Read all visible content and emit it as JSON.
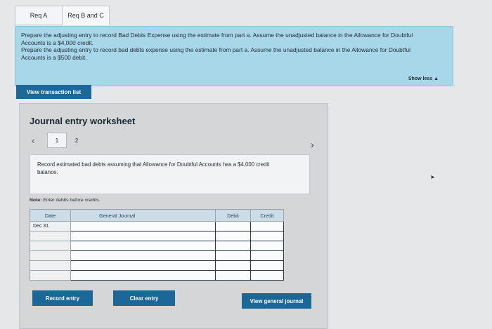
{
  "tabs": [
    {
      "label": "Req A"
    },
    {
      "label": "Req B and C"
    }
  ],
  "instructions": {
    "line1": "Prepare the adjusting entry to record Bad Debts Expense using the estimate from part a. Assume the unadjusted balance in the Allowance for Doubtful Accounts is a $4,000 credit.",
    "line2": "Prepare the adjusting entry to record bad debts expense using the estimate from part a. Assume the unadjusted balance in the Allowance for Doubtful Accounts is a $500 debit.",
    "show_less": "Show less ▲"
  },
  "view_transaction_list": "View transaction list",
  "worksheet": {
    "title": "Journal entry worksheet",
    "prev_icon": "‹",
    "next_icon": "›",
    "pages": [
      "1",
      "2"
    ],
    "description": "Record estimated bad debts assuming that Allowance for Doubtful Accounts has a $4,000 credit balance.",
    "note_label": "Note:",
    "note_text": "Enter debits before credits.",
    "table": {
      "headers": {
        "date": "Date",
        "journal": "General Journal",
        "debit": "Debit",
        "credit": "Credit"
      },
      "first_date": "Dec 31"
    },
    "buttons": {
      "record": "Record entry",
      "clear": "Clear entry",
      "view_journal": "View general journal"
    }
  }
}
